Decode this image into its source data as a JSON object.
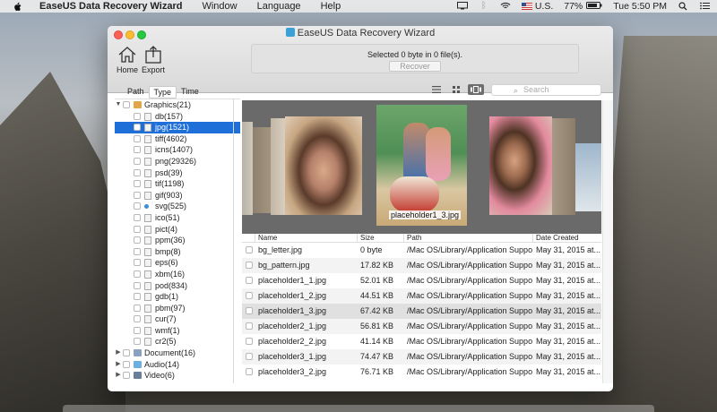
{
  "menubar": {
    "apple": "",
    "app_name": "EaseUS Data Recovery Wizard",
    "items": [
      "Window",
      "Language",
      "Help"
    ],
    "input_source": "U.S.",
    "battery": "77%",
    "clock": "Tue 5:50 PM"
  },
  "window": {
    "title": "EaseUS Data Recovery Wizard",
    "toolbar": {
      "home": "Home",
      "export": "Export"
    },
    "status": {
      "text": "Selected 0 byte in 0 file(s).",
      "recover": "Recover"
    },
    "tabs": [
      "Path",
      "Type",
      "Time"
    ],
    "active_tab": "Type",
    "search_placeholder": "Search"
  },
  "tree": [
    {
      "label": "Graphics(21)",
      "level": 0,
      "expanded": true,
      "icon": "folder-image-icon"
    },
    {
      "label": "db(157)",
      "level": 1,
      "icon": "file-icon"
    },
    {
      "label": "jpg(1521)",
      "level": 1,
      "icon": "image-file-icon",
      "selected": true
    },
    {
      "label": "tiff(4602)",
      "level": 1,
      "icon": "image-file-icon"
    },
    {
      "label": "icns(1407)",
      "level": 1,
      "icon": "image-file-icon"
    },
    {
      "label": "png(29326)",
      "level": 1,
      "icon": "image-file-icon"
    },
    {
      "label": "psd(39)",
      "level": 1,
      "icon": "image-file-icon"
    },
    {
      "label": "tif(1198)",
      "level": 1,
      "icon": "image-file-icon"
    },
    {
      "label": "gif(903)",
      "level": 1,
      "icon": "image-file-icon"
    },
    {
      "label": "svg(525)",
      "level": 1,
      "icon": "svg-file-icon"
    },
    {
      "label": "ico(51)",
      "level": 1,
      "icon": "image-file-icon"
    },
    {
      "label": "pict(4)",
      "level": 1,
      "icon": "image-file-icon"
    },
    {
      "label": "ppm(36)",
      "level": 1,
      "icon": "file-icon"
    },
    {
      "label": "bmp(8)",
      "level": 1,
      "icon": "image-file-icon"
    },
    {
      "label": "eps(6)",
      "level": 1,
      "icon": "image-file-icon"
    },
    {
      "label": "xbm(16)",
      "level": 1,
      "icon": "image-file-icon"
    },
    {
      "label": "pod(834)",
      "level": 1,
      "icon": "file-icon"
    },
    {
      "label": "gdb(1)",
      "level": 1,
      "icon": "file-icon"
    },
    {
      "label": "pbm(97)",
      "level": 1,
      "icon": "file-icon"
    },
    {
      "label": "cur(7)",
      "level": 1,
      "icon": "file-icon"
    },
    {
      "label": "wmf(1)",
      "level": 1,
      "icon": "file-icon"
    },
    {
      "label": "cr2(5)",
      "level": 1,
      "icon": "image-file-icon"
    },
    {
      "label": "Document(16)",
      "level": 0,
      "expanded": false,
      "icon": "folder-document-icon"
    },
    {
      "label": "Audio(14)",
      "level": 0,
      "expanded": false,
      "icon": "folder-audio-icon"
    },
    {
      "label": "Video(6)",
      "level": 0,
      "expanded": false,
      "icon": "folder-video-icon"
    }
  ],
  "preview": {
    "caption": "placeholder1_3.jpg"
  },
  "table": {
    "headers": [
      "Name",
      "Size",
      "Path",
      "Date Created"
    ],
    "rows": [
      [
        "bg_letter.jpg",
        "0 byte",
        "/Mac OS/Library/Application Suppo...",
        "May 31, 2015 at..."
      ],
      [
        "bg_pattern.jpg",
        "17.82 KB",
        "/Mac OS/Library/Application Suppo...",
        "May 31, 2015 at..."
      ],
      [
        "placeholder1_1.jpg",
        "52.01 KB",
        "/Mac OS/Library/Application Suppo...",
        "May 31, 2015 at..."
      ],
      [
        "placeholder1_2.jpg",
        "44.51 KB",
        "/Mac OS/Library/Application Suppo...",
        "May 31, 2015 at..."
      ],
      [
        "placeholder1_3.jpg",
        "67.42 KB",
        "/Mac OS/Library/Application Suppo...",
        "May 31, 2015 at..."
      ],
      [
        "placeholder2_1.jpg",
        "56.81 KB",
        "/Mac OS/Library/Application Suppo...",
        "May 31, 2015 at..."
      ],
      [
        "placeholder2_2.jpg",
        "41.14 KB",
        "/Mac OS/Library/Application Suppo...",
        "May 31, 2015 at..."
      ],
      [
        "placeholder3_1.jpg",
        "74.47 KB",
        "/Mac OS/Library/Application Suppo...",
        "May 31, 2015 at..."
      ],
      [
        "placeholder3_2.jpg",
        "76.71 KB",
        "/Mac OS/Library/Application Suppo...",
        "May 31, 2015 at..."
      ]
    ]
  },
  "colors": {
    "selection": "#1f6fd8",
    "accent": "#3aa0d8"
  }
}
